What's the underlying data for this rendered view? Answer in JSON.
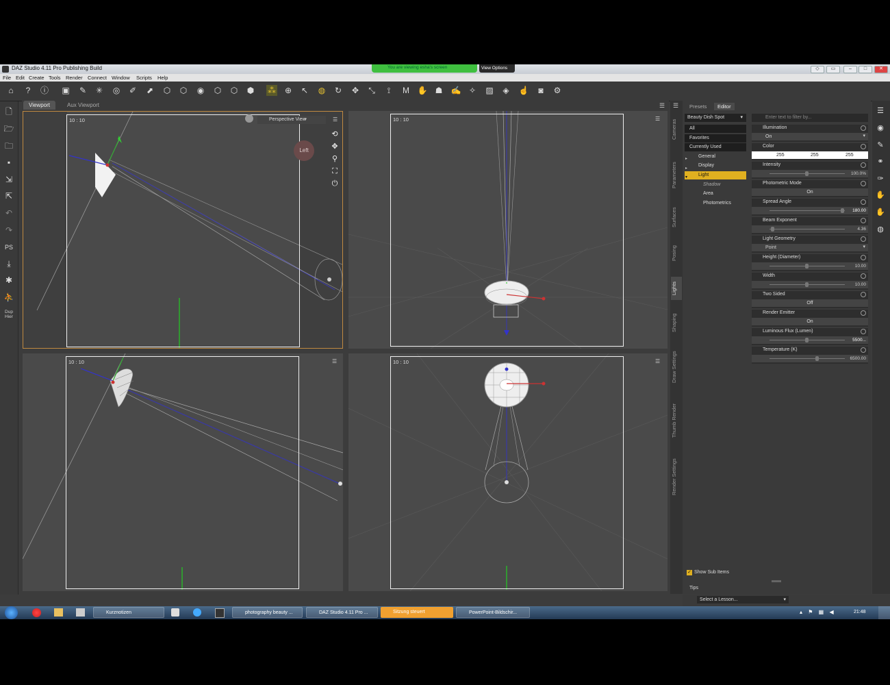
{
  "window": {
    "title": "DAZ Studio 4.11 Pro Publishing Build",
    "share_notice": "You are viewing esha's screen",
    "view_options": "View Options"
  },
  "menu": [
    "File",
    "Edit",
    "Create",
    "Tools",
    "Render",
    "Connect",
    "Window",
    "Scripts",
    "Help"
  ],
  "viewport_tabs": {
    "active": "Viewport",
    "other": "Aux Viewport"
  },
  "viewports": {
    "top_left": {
      "ratio": "10 : 10",
      "view": "Perspective View",
      "badge": "Left"
    },
    "top_right": {
      "ratio": "10 : 10"
    },
    "bottom_left": {
      "ratio": "10 : 10"
    },
    "bottom_right": {
      "ratio": "10 : 10"
    }
  },
  "left_tools": {
    "dup_label": "Dup Hier",
    "ps_label": "PS"
  },
  "side_tabs": [
    "Cameras",
    "Parameters",
    "Surfaces",
    "Posing",
    "Lights",
    "Shaping",
    "Draw Settings",
    "Thumb Render",
    "Render Settings"
  ],
  "pane": {
    "tabs": [
      "Presets",
      "Editor"
    ],
    "node": "Beauty Dish Spot",
    "filter_placeholder": "Enter text to filter by...",
    "groups": [
      "All",
      "Favorites",
      "Currently Used",
      "General",
      "Display",
      "Light",
      "Shadow",
      "Area",
      "Photometrics"
    ],
    "properties": [
      {
        "label": "Illumination",
        "value": "On"
      },
      {
        "label": "Color",
        "r": "255",
        "g": "255",
        "b": "255"
      },
      {
        "label": "Intensity",
        "value": "100.0%"
      },
      {
        "label": "Photometric Mode",
        "value": "On"
      },
      {
        "label": "Spread Angle",
        "value": "180.00"
      },
      {
        "label": "Beam Exponent",
        "value": "4.36"
      },
      {
        "label": "Light Geometry",
        "value": "Point"
      },
      {
        "label": "Height (Diameter)",
        "value": "10.00"
      },
      {
        "label": "Width",
        "value": "10.00"
      },
      {
        "label": "Two Sided",
        "value": "Off"
      },
      {
        "label": "Render Emitter",
        "value": "On"
      },
      {
        "label": "Luminous Flux (Lumen)",
        "value": "5500..."
      },
      {
        "label": "Temperature (K)",
        "value": "6500.00"
      }
    ],
    "show_sub_items": "Show Sub Items",
    "tips": "Tips",
    "lesson": "Select a Lesson..."
  },
  "taskbar": {
    "items": [
      "Kurznotizen",
      "photography beauty ...",
      "DAZ Studio 4.11 Pro ...",
      "Sitzung steuert",
      "PowerPoint-Bildschir..."
    ],
    "clock": "21:48"
  }
}
